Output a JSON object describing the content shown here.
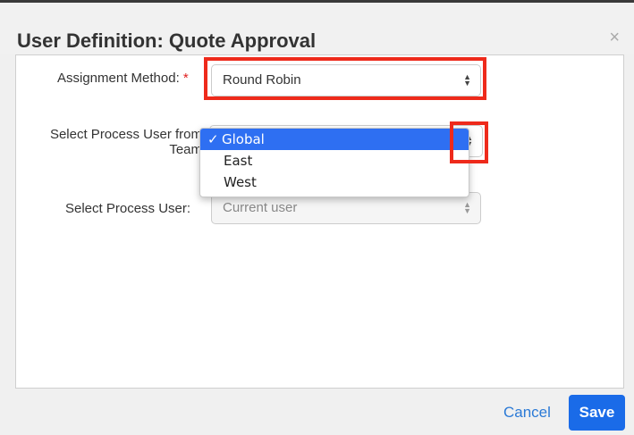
{
  "modal": {
    "title": "User Definition: Quote Approval",
    "close_icon": "×"
  },
  "fields": {
    "assignment_method": {
      "label": "Assignment Method:",
      "required_marker": "*",
      "value": "Round Robin"
    },
    "process_user_from": {
      "label_line1": "Select Process User from",
      "label_line2": "Team"
    },
    "process_user": {
      "label": "Select Process User:",
      "value": "Current user"
    }
  },
  "dropdown": {
    "options": [
      {
        "label": "Global",
        "selected": true,
        "check": "✓"
      },
      {
        "label": "East",
        "selected": false
      },
      {
        "label": "West",
        "selected": false
      }
    ]
  },
  "footer": {
    "cancel_label": "Cancel",
    "save_label": "Save"
  },
  "colors": {
    "highlight": "#ee2a1b",
    "primary": "#1a6be8",
    "selected_option": "#2e6ff2"
  }
}
